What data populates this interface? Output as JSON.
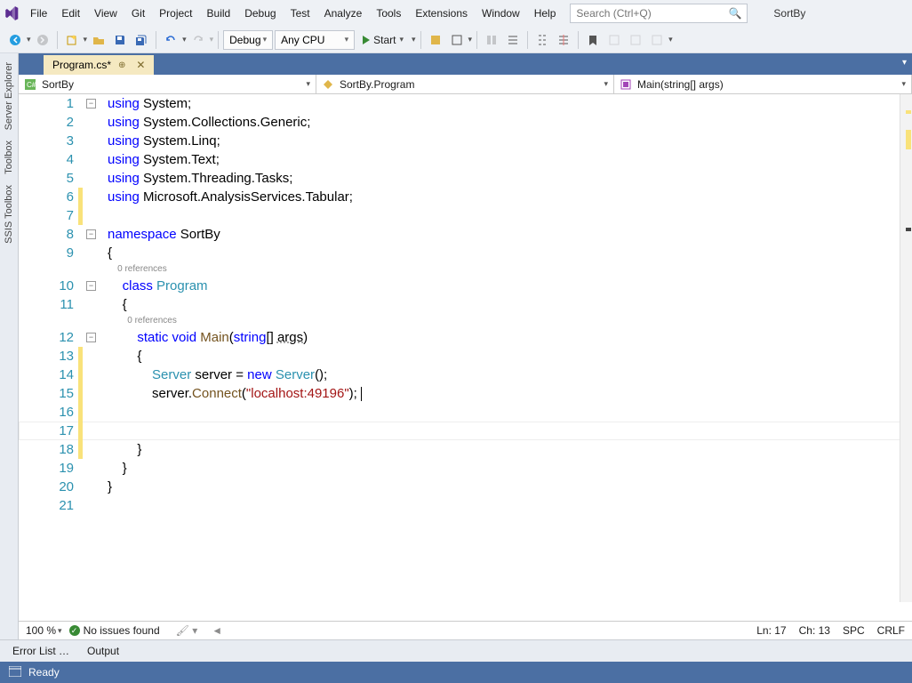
{
  "menu": {
    "items": [
      "File",
      "Edit",
      "View",
      "Git",
      "Project",
      "Build",
      "Debug",
      "Test",
      "Analyze",
      "Tools",
      "Extensions",
      "Window",
      "Help"
    ]
  },
  "search": {
    "placeholder": "Search (Ctrl+Q)"
  },
  "solution_name": "SortBy",
  "toolbar": {
    "config": "Debug",
    "platform": "Any CPU",
    "start": "Start"
  },
  "siderail": {
    "tabs": [
      "Server Explorer",
      "Toolbox",
      "SSIS Toolbox"
    ]
  },
  "filetab": {
    "name": "Program.cs*"
  },
  "nav": {
    "scope": "SortBy",
    "class": "SortBy.Program",
    "member": "Main(string[] args)"
  },
  "refs": {
    "zero": "0 references"
  },
  "code": {
    "l1": {
      "kw": "using",
      "id": "System"
    },
    "l2": {
      "kw": "using",
      "id": "System.Collections.Generic"
    },
    "l3": {
      "kw": "using",
      "id": "System.Linq"
    },
    "l4": {
      "kw": "using",
      "id": "System.Text"
    },
    "l5": {
      "kw": "using",
      "id": "System.Threading.Tasks"
    },
    "l6": {
      "kw": "using",
      "id": "Microsoft.AnalysisServices.Tabular"
    },
    "l8": {
      "kw": "namespace",
      "id": "SortBy"
    },
    "l10": {
      "kw": "class",
      "id": "Program"
    },
    "l12": {
      "kw1": "static",
      "kw2": "void",
      "met": "Main",
      "kw3": "string",
      "arg": "args"
    },
    "l14": {
      "cls": "Server",
      "var": "server",
      "kw": "new",
      "cls2": "Server"
    },
    "l15": {
      "var": "server",
      "met": "Connect",
      "str": "\"localhost:49196\""
    }
  },
  "ed_status": {
    "zoom": "100 %",
    "issues": "No issues found",
    "ln": "Ln: 17",
    "ch": "Ch: 13",
    "spc": "SPC",
    "crlf": "CRLF"
  },
  "bottom_tabs": {
    "items": [
      "Error List …",
      "Output"
    ]
  },
  "statusbar": {
    "text": "Ready"
  }
}
